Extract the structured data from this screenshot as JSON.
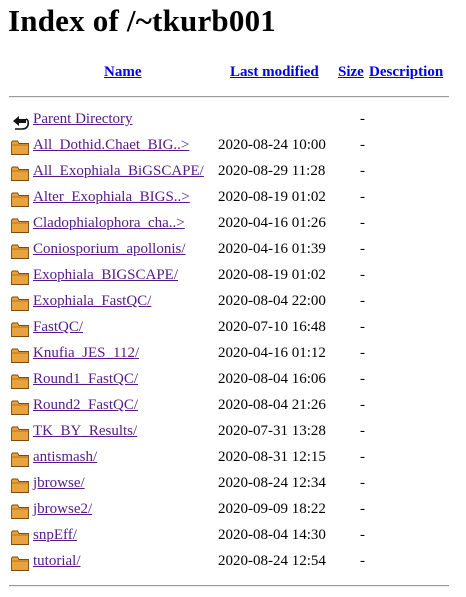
{
  "page": {
    "title": "Index of /~tkurb001"
  },
  "columns": {
    "name": "Name",
    "last_modified": "Last modified",
    "size": "Size",
    "description": "Description"
  },
  "parent": {
    "label": "Parent Directory",
    "size": "-",
    "icon": "back-arrow-icon"
  },
  "rows": [
    {
      "name": "All_Dothid.Chaet_BIG..>",
      "date": "2020-08-24 10:00",
      "size": "-",
      "icon": "folder-icon"
    },
    {
      "name": "All_Exophiala_BiGSCAPE/",
      "date": "2020-08-29 11:28",
      "size": "-",
      "icon": "folder-icon"
    },
    {
      "name": "Alter_Exophiala_BIGS..>",
      "date": "2020-08-19 01:02",
      "size": "-",
      "icon": "folder-icon"
    },
    {
      "name": "Cladophialophora_cha..>",
      "date": "2020-04-16 01:26",
      "size": "-",
      "icon": "folder-icon"
    },
    {
      "name": "Coniosporium_apollonis/",
      "date": "2020-04-16 01:39",
      "size": "-",
      "icon": "folder-icon"
    },
    {
      "name": "Exophiala_BIGSCAPE/",
      "date": "2020-08-19 01:02",
      "size": "-",
      "icon": "folder-icon"
    },
    {
      "name": "Exophiala_FastQC/",
      "date": "2020-08-04 22:00",
      "size": "-",
      "icon": "folder-icon"
    },
    {
      "name": "FastQC/",
      "date": "2020-07-10 16:48",
      "size": "-",
      "icon": "folder-icon"
    },
    {
      "name": "Knufia_JES_112/",
      "date": "2020-04-16 01:12",
      "size": "-",
      "icon": "folder-icon"
    },
    {
      "name": "Round1_FastQC/",
      "date": "2020-08-04 16:06",
      "size": "-",
      "icon": "folder-icon"
    },
    {
      "name": "Round2_FastQC/",
      "date": "2020-08-04 21:26",
      "size": "-",
      "icon": "folder-icon"
    },
    {
      "name": "TK_BY_Results/",
      "date": "2020-07-31 13:28",
      "size": "-",
      "icon": "folder-icon"
    },
    {
      "name": "antismash/",
      "date": "2020-08-31 12:15",
      "size": "-",
      "icon": "folder-icon"
    },
    {
      "name": "jbrowse/",
      "date": "2020-08-24 12:34",
      "size": "-",
      "icon": "folder-icon"
    },
    {
      "name": "jbrowse2/",
      "date": "2020-09-09 18:22",
      "size": "-",
      "icon": "folder-icon"
    },
    {
      "name": "snpEff/",
      "date": "2020-08-04 14:30",
      "size": "-",
      "icon": "folder-icon"
    },
    {
      "name": "tutorial/",
      "date": "2020-08-24 12:54",
      "size": "-",
      "icon": "folder-icon"
    }
  ],
  "colors": {
    "visited_link": "#551a8b",
    "header_link": "#0000ee",
    "folder": "#e8a33d"
  }
}
